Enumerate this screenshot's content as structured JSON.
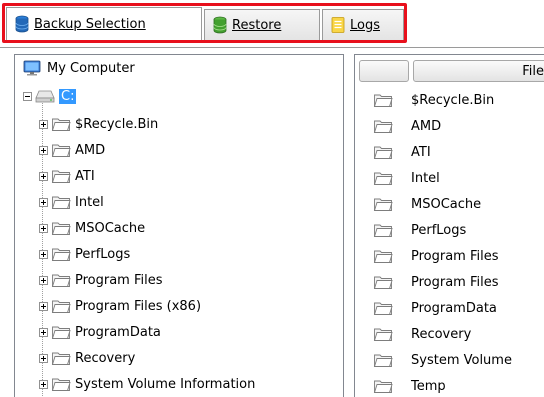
{
  "tabs": [
    {
      "label": "Backup Selection",
      "icon": "database-icon",
      "active": true
    },
    {
      "label": "Restore",
      "icon": "database-green-icon",
      "active": false
    },
    {
      "label": "Logs",
      "icon": "log-notepad-icon",
      "active": false
    }
  ],
  "tree": {
    "root_label": "My Computer",
    "drive_label": "C:",
    "folders": [
      "$Recycle.Bin",
      "AMD",
      "ATI",
      "Intel",
      "MSOCache",
      "PerfLogs",
      "Program Files",
      "Program Files (x86)",
      "ProgramData",
      "Recovery",
      "System Volume Information"
    ]
  },
  "file_list": {
    "column_header": "File",
    "items": [
      "$Recycle.Bin",
      "AMD",
      "ATI",
      "Intel",
      "MSOCache",
      "PerfLogs",
      "Program Files",
      "Program Files",
      "ProgramData",
      "Recovery",
      "System Volume",
      "Temp"
    ]
  },
  "colors": {
    "highlight_border": "#e8101c",
    "selection": "#3399ff"
  }
}
